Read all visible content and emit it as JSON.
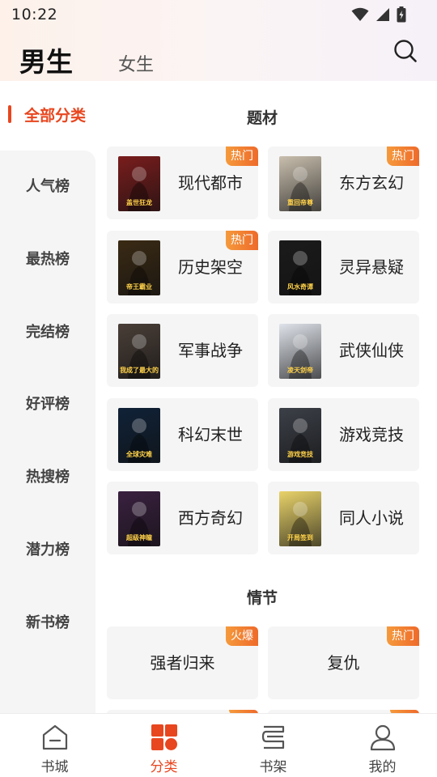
{
  "status": {
    "time": "10:22"
  },
  "header": {
    "tab_male": "男生",
    "tab_female": "女生"
  },
  "sidebar": {
    "active": "全部分类",
    "items": [
      "人气榜",
      "最热榜",
      "完结榜",
      "好评榜",
      "热搜榜",
      "潜力榜",
      "新书榜"
    ]
  },
  "topic": {
    "title": "题材",
    "cards": [
      {
        "name": "现代都市",
        "badge": "热门",
        "cover_text": "盖世狂龙",
        "cover_color": "#7a1d1d"
      },
      {
        "name": "东方玄幻",
        "badge": "热门",
        "cover_text": "重回帝尊",
        "cover_color": "#c9bfae"
      },
      {
        "name": "历史架空",
        "badge": "热门",
        "cover_text": "帝王霸业",
        "cover_color": "#3a2a14"
      },
      {
        "name": "灵异悬疑",
        "badge": "",
        "cover_text": "风水奇谭",
        "cover_color": "#1b1b1b"
      },
      {
        "name": "军事战争",
        "badge": "",
        "cover_text": "我成了最大的",
        "cover_color": "#4a3f38"
      },
      {
        "name": "武侠仙侠",
        "badge": "",
        "cover_text": "凌天剑帝",
        "cover_color": "#dfe3ea"
      },
      {
        "name": "科幻末世",
        "badge": "",
        "cover_text": "全球灾难",
        "cover_color": "#102238"
      },
      {
        "name": "游戏竞技",
        "badge": "",
        "cover_text": "游戏竞技",
        "cover_color": "#3c4048"
      },
      {
        "name": "西方奇幻",
        "badge": "",
        "cover_text": "超级神瞳",
        "cover_color": "#3a2140"
      },
      {
        "name": "同人小说",
        "badge": "",
        "cover_text": "开局签到",
        "cover_color": "#e9d36a"
      }
    ]
  },
  "plot": {
    "title": "情节",
    "cards": [
      {
        "name": "强者归来",
        "badge": "火爆"
      },
      {
        "name": "复仇",
        "badge": "热门"
      }
    ]
  },
  "nav": {
    "items": [
      {
        "label": "书城",
        "icon": "bookstore-icon"
      },
      {
        "label": "分类",
        "icon": "category-icon"
      },
      {
        "label": "书架",
        "icon": "bookshelf-icon"
      },
      {
        "label": "我的",
        "icon": "profile-icon"
      }
    ],
    "active_color": "#e8461f"
  },
  "colors": {
    "accent": "#e8461f",
    "badge": "#f08a33"
  }
}
